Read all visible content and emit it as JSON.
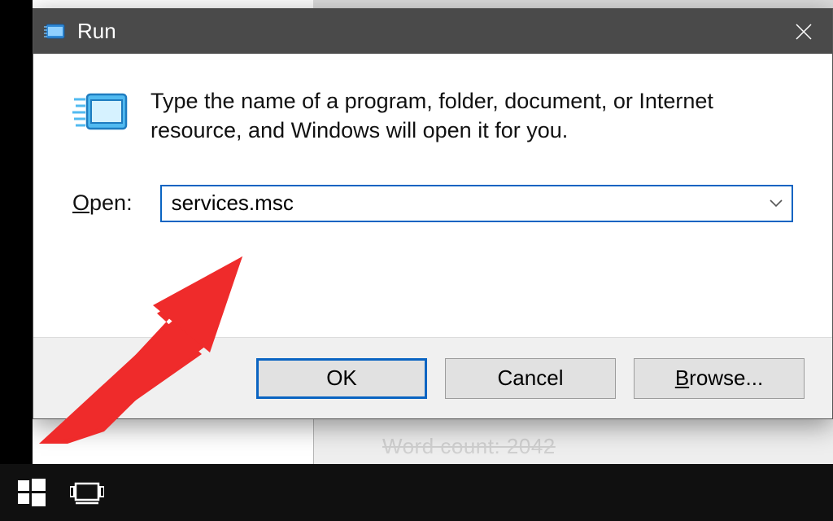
{
  "run_dialog": {
    "title": "Run",
    "description": "Type the name of a program, folder, document, or Internet resource, and Windows will open it for you.",
    "open_label_pre": "O",
    "open_label_post": "pen:",
    "input_value": "services.msc",
    "buttons": {
      "ok": "OK",
      "cancel": "Cancel",
      "browse_pre": "B",
      "browse_post": "rowse..."
    }
  },
  "background": {
    "partial_text": "Word count: 2042"
  }
}
